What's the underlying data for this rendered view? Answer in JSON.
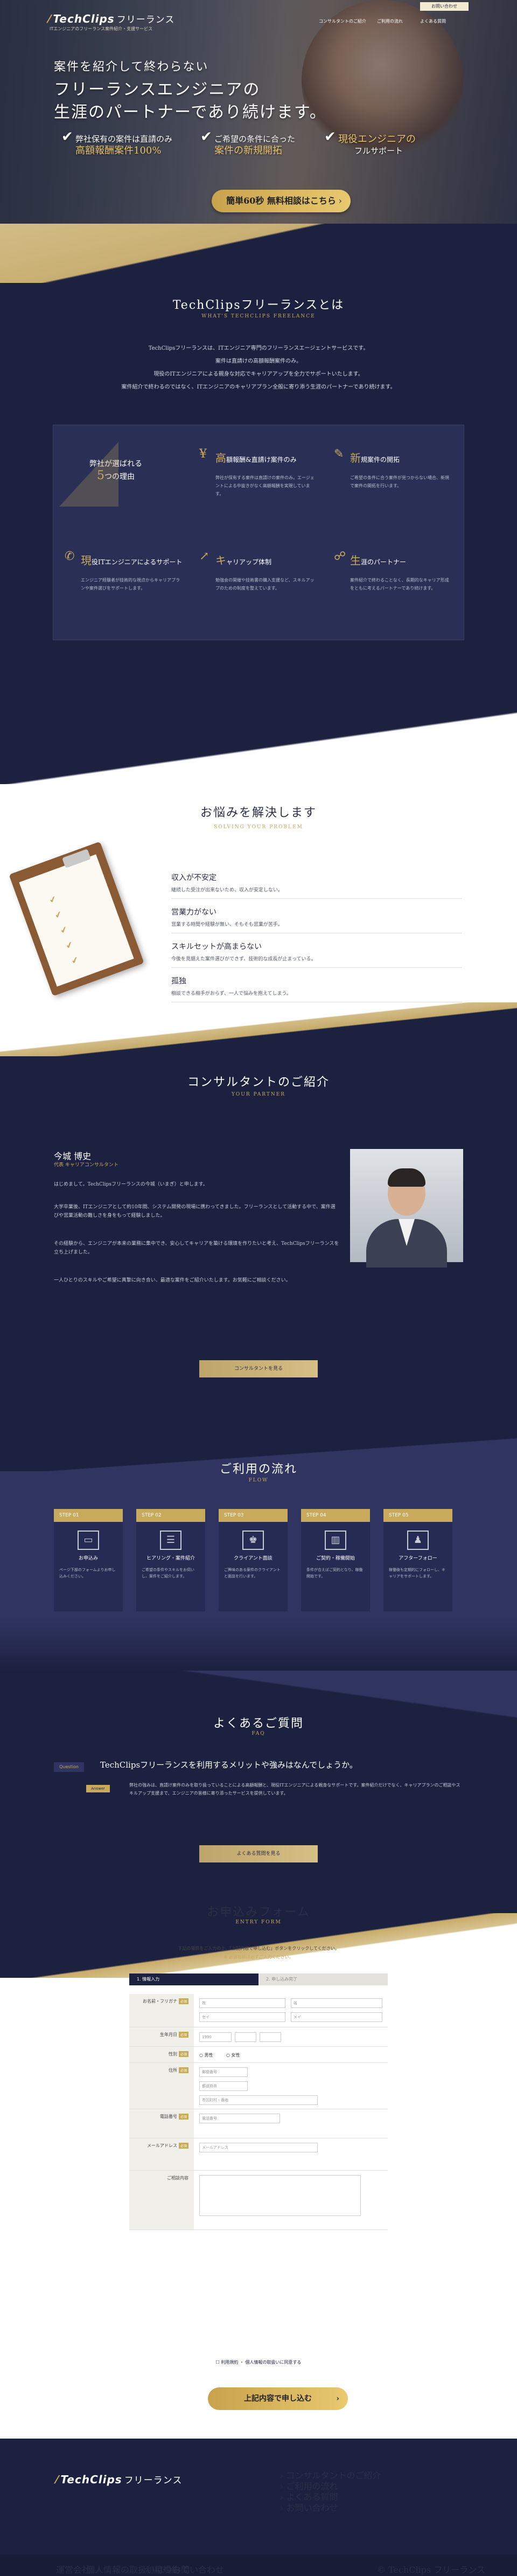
{
  "header": {
    "logo_text": "TechClips",
    "logo_ja": "フリーランス",
    "tagline": "ITエンジニアのフリーランス案件紹介・支援サービス",
    "cta": "お問い合わせ",
    "nav": [
      "コンサルタントのご紹介",
      "ご利用の流れ",
      "よくある質問"
    ]
  },
  "hero": {
    "title_line1": "案件を紹介して終わらない",
    "title_line2": "フリーランスエンジニアの",
    "title_line3": "生涯のパートナーであり続けます。",
    "features": [
      {
        "line1": "弊社保有の案件は直請のみ",
        "line2": "高額報酬案件",
        "percent": "100%"
      },
      {
        "line1": "ご希望の条件に合った",
        "line2": "案件の新規開拓"
      },
      {
        "line1": "現役エンジニアの",
        "line2": "フルサポート"
      }
    ],
    "cta": "簡単60秒 無料相談はこちら"
  },
  "about": {
    "title": "TechClipsフリーランスとは",
    "sub": "WHAT'S TECHCLIPS FREELANCE",
    "lines": [
      "TechClipsフリーランスは、ITエンジニア専門のフリーランスエージェントサービスです。",
      "案件は直請けの高額報酬案件のみ。",
      "現役のITエンジニアによる親身な対応でキャリアアップを全力でサポートいたします。",
      "案件紹介で終わるのではなく、ITエンジニアのキャリアプラン全般に寄り添う生涯のパートナーであり続けます。"
    ],
    "reason_top": "弊社が選ばれる",
    "reason_num": "5",
    "reason_bottom": "つの理由",
    "cards": [
      {
        "cap": "高",
        "title": "額報酬&直請け案件のみ",
        "text": "弊社が保有する案件は直請けの案件のみ。エージェントによる中抜きがなく高額報酬を実現しています。"
      },
      {
        "cap": "新",
        "title": "規案件の開拓",
        "text": "ご希望の条件に合う案件が見つからない場合、新規で案件の開拓を行います。"
      },
      {
        "cap": "現",
        "title": "役ITエンジニアによるサポート",
        "text": "エンジニア経験者が技術的な視点からキャリアプランや案件選びをサポートします。"
      },
      {
        "cap": "キ",
        "title": "ャリアップ体制",
        "text": "勉強会の開催や技術書の購入支援など、スキルアップのための制度を整えています。"
      },
      {
        "cap": "生",
        "title": "涯のパートナー",
        "text": "案件紹介で終わることなく、長期的なキャリア形成をともに考えるパートナーであり続けます。"
      }
    ]
  },
  "problem": {
    "title": "お悩みを解決します",
    "sub": "SOLVING YOUR PROBLEM",
    "items": [
      {
        "head": "収入が不安定",
        "desc": "継続した受注が出来ないため、収入が安定しない。"
      },
      {
        "head": "営業力がない",
        "desc": "営業する時間や経験が無い、そもそも営業が苦手。"
      },
      {
        "head": "スキルセットが高まらない",
        "desc": "今後を見据えた案件選びができず、技術的な成長が止まっている。"
      },
      {
        "head": "孤独",
        "desc": "相談できる相手がおらず、一人で悩みを抱えてしまう。"
      }
    ]
  },
  "consultant": {
    "title": "コンサルタントのご紹介",
    "sub": "YOUR PARTNER",
    "name": "今城 博史",
    "role": "代表 キャリアコンサルタント",
    "paragraphs": [
      "はじめまして。TechClipsフリーランスの今城（いまぎ）と申します。",
      "大学卒業後、ITエンジニアとして約10年間、システム開発の現場に携わってきました。フリーランスとして活動する中で、案件選びや営業活動の難しさを身をもって経験しました。",
      "その経験から、エンジニアが本来の業務に集中でき、安心してキャリアを築ける環境を作りたいと考え、TechClipsフリーランスを立ち上げました。",
      "一人ひとりのスキルやご希望に真摯に向き合い、最適な案件をご紹介いたします。お気軽にご相談ください。"
    ],
    "button": "コンサルタントを見る"
  },
  "flow": {
    "title": "ご利用の流れ",
    "sub": "FLOW",
    "steps": [
      {
        "label": "STEP 01",
        "name": "お申込み",
        "icon": "monitor-icon",
        "glyph": "▭",
        "desc": "ページ下部のフォームよりお申し込みください。"
      },
      {
        "label": "STEP 02",
        "name": "ヒアリング・案件紹介",
        "icon": "clipboard-icon",
        "glyph": "☰",
        "desc": "ご希望の条件やスキルをお伺いし、案件をご紹介します。"
      },
      {
        "label": "STEP 03",
        "name": "クライアント面談",
        "icon": "meeting-icon",
        "glyph": "♚",
        "desc": "ご興味のある案件のクライアントと面談を行います。"
      },
      {
        "label": "STEP 04",
        "name": "ご契約・稼働開始",
        "icon": "office-icon",
        "glyph": "▥",
        "desc": "条件が合えばご契約となり、稼働開始です。"
      },
      {
        "label": "STEP 05",
        "name": "アフターフォロー",
        "icon": "people-icon",
        "glyph": "♟",
        "desc": "稼働後も定期的にフォローし、キャリアをサポートします。"
      }
    ]
  },
  "faq": {
    "title": "よくあるご質問",
    "sub": "FAQ",
    "q_badge": "Question",
    "a_badge": "Answer",
    "question": "TechClipsフリーランスを利用するメリットや強みはなんでしょうか。",
    "answer": "弊社の強みは、直請け案件のみを取り扱っていることによる高額報酬と、現役ITエンジニアによる親身なサポートです。案件紹介だけでなく、キャリアプランのご相談やスキルアップ支援まで、エンジニアの皆様に寄り添ったサービスを提供しています。",
    "button": "よくある質問を見る"
  },
  "form": {
    "title": "お申込みフォーム",
    "sub": "ENTRY FORM",
    "intro": "下記の項目をご入力の上、「上記内容で申し込む」ボタンをクリックしてください。",
    "intro2": "※ 必須項目は必ずご入力ください。",
    "tab_active": "1. 情報入力",
    "tab_inactive": "2. 申し込み完了",
    "required": "必須",
    "rows": [
      {
        "label": "お名前・フリガナ"
      },
      {
        "label": "生年月日"
      },
      {
        "label": "性別"
      },
      {
        "label": "住所"
      },
      {
        "label": "電話番号"
      },
      {
        "label": "メールアドレス"
      },
      {
        "label": "ご相談内容"
      }
    ],
    "ph_last": "姓",
    "ph_first": "名",
    "ph_kana_last": "セイ",
    "ph_kana_first": "メイ",
    "ph_birth": "1990",
    "gender_m": "男性",
    "gender_f": "女性",
    "ph_zip": "郵便番号",
    "ph_pref": "都道府県",
    "ph_addr": "市区町村・番地",
    "ph_tel": "電話番号",
    "ph_mail": "メールアドレス",
    "agree": "利用規約 ・ 個人情報の取扱いに同意する",
    "submit": "上記内容で申し込む"
  },
  "footer": {
    "logo": "TechClips",
    "logo_ja": "フリーランス",
    "links": [
      "コンサルタントのご紹介",
      "ご利用の流れ",
      "よくある質問",
      "お問い合わせ"
    ],
    "bottom_links": [
      "運営会社",
      "個人情報の取扱いについて",
      "利用規約",
      "お問い合わせ"
    ],
    "copyright": "© TechClips フリーランス"
  },
  "colors": {
    "navy": "#1c2140",
    "gold": "#c9a95b"
  }
}
